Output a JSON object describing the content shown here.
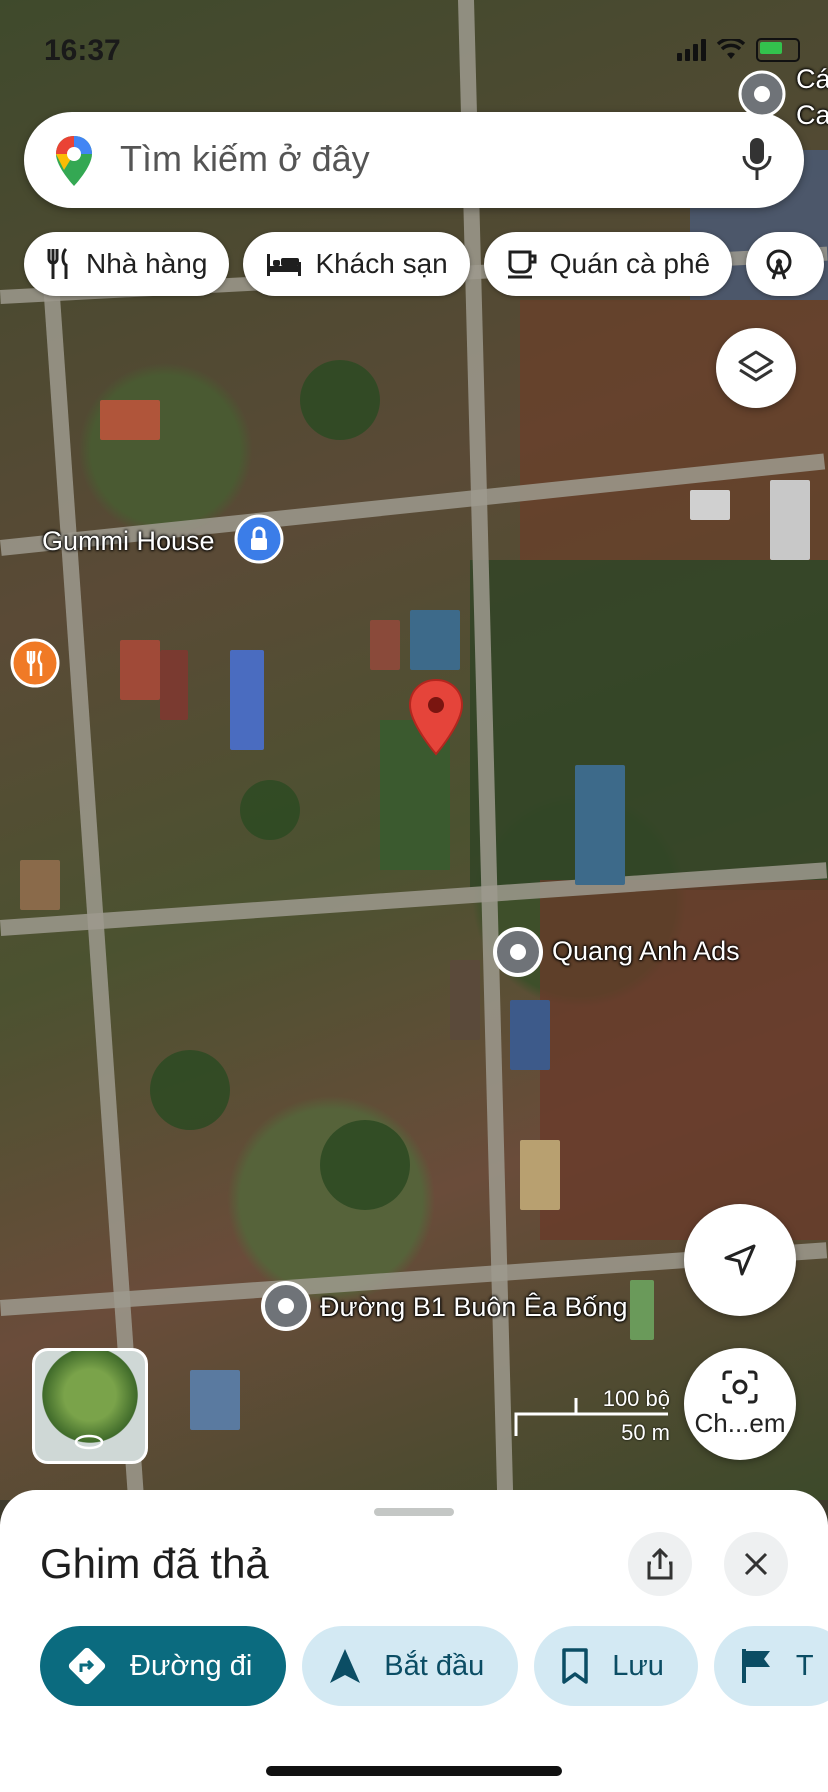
{
  "status_bar": {
    "time": "16:37"
  },
  "search": {
    "placeholder": "Tìm kiếm ở đây"
  },
  "chips": [
    {
      "label": "Nhà hàng",
      "icon": "utensils-icon"
    },
    {
      "label": "Khách sạn",
      "icon": "bed-icon"
    },
    {
      "label": "Quán cà phê",
      "icon": "coffee-cup-icon"
    }
  ],
  "map": {
    "labels": {
      "gummi_house": "Gummi House",
      "quang_anh_ads": "Quang Anh Ads",
      "duong_b1": "Đường B1 Buôn Êa Bống",
      "top_right_partial_1": "Cá",
      "top_right_partial_2": "Ca"
    },
    "street_view_button_label": "Ch...em",
    "scale": {
      "imperial": "100 bộ",
      "metric": "50 m"
    }
  },
  "sheet": {
    "title": "Ghim đã thả",
    "actions": [
      {
        "label": "Đường đi",
        "icon": "directions-icon"
      },
      {
        "label": "Bắt đầu",
        "icon": "navigation-arrow-icon"
      },
      {
        "label": "Lưu",
        "icon": "bookmark-icon"
      },
      {
        "label": "T",
        "icon": "flag-icon"
      }
    ]
  },
  "colors": {
    "accent": "#0b6b7f",
    "pin": "#e5443a",
    "action_bg": "#d3e9f3"
  }
}
